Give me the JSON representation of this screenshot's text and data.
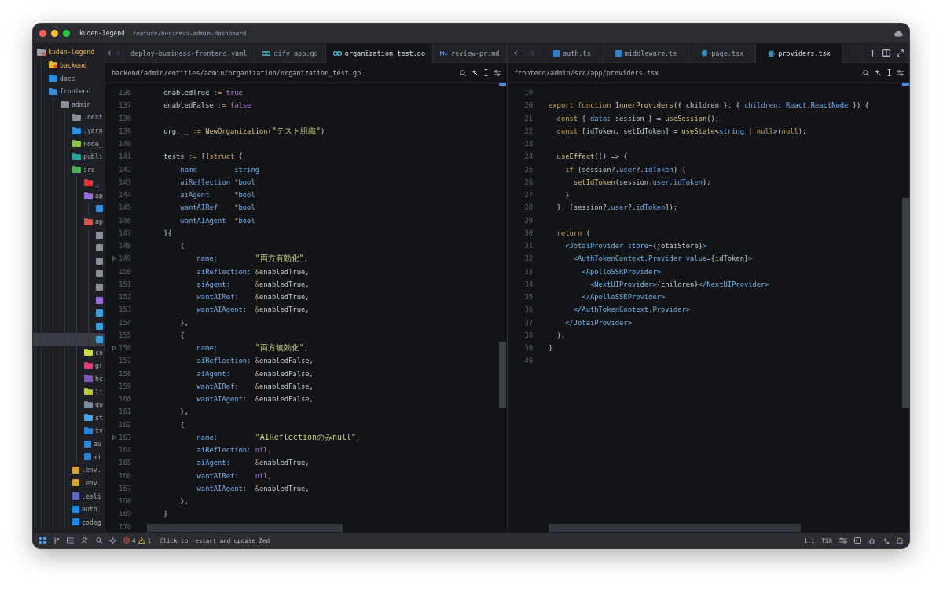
{
  "title_bar": {
    "project": "kuden-legend",
    "branch": "feature/business-admin-dashboard"
  },
  "sidebar": {
    "items": [
      {
        "label": "kuden-legend",
        "kind": "folder",
        "color": "#9aa0a8",
        "modified": true,
        "selected": false,
        "children": [
          {
            "label": "backend",
            "kind": "folder",
            "color": "#e8b730",
            "modified": true,
            "selected": false
          },
          {
            "label": "docs",
            "kind": "folder",
            "color": "#2f8fe0",
            "modified": false,
            "selected": false
          },
          {
            "label": "frontend",
            "kind": "folder",
            "color": "#3a8fd6",
            "modified": false,
            "selected": false,
            "children": [
              {
                "label": "admin",
                "kind": "folder",
                "color": "#8a8f98",
                "modified": false,
                "selected": false,
                "children": [
                  {
                    "label": ".next",
                    "kind": "folder",
                    "color": "#8a8f98",
                    "modified": false,
                    "selected": false
                  },
                  {
                    "label": ".yarn",
                    "kind": "folder",
                    "color": "#2f8fe0",
                    "modified": false,
                    "selected": false
                  },
                  {
                    "label": "node_",
                    "kind": "folder",
                    "color": "#8bc34a",
                    "modified": false,
                    "selected": false
                  },
                  {
                    "label": "publi",
                    "kind": "folder",
                    "color": "#26a69a",
                    "modified": false,
                    "selected": false
                  },
                  {
                    "label": "src",
                    "kind": "folder",
                    "color": "#4caf50",
                    "modified": false,
                    "selected": false,
                    "children": [
                      {
                        "label": "_",
                        "kind": "folder",
                        "color": "#e53935",
                        "modified": false,
                        "selected": false
                      },
                      {
                        "label": "ap",
                        "kind": "folder",
                        "color": "#9c6ade",
                        "modified": false,
                        "selected": false,
                        "children": [
                          {
                            "kind": "file",
                            "color": "#2f8fe0",
                            "modified": false,
                            "selected": false
                          }
                        ]
                      },
                      {
                        "label": "ap",
                        "kind": "folder",
                        "color": "#e35050",
                        "modified": false,
                        "selected": false,
                        "children": [
                          {
                            "kind": "file",
                            "color": "#8a8f98",
                            "modified": false,
                            "selected": false
                          },
                          {
                            "kind": "file",
                            "color": "#8a8f98",
                            "modified": false,
                            "selected": false
                          },
                          {
                            "kind": "file",
                            "color": "#8a8f98",
                            "modified": false,
                            "selected": false
                          },
                          {
                            "kind": "file",
                            "color": "#8a8f98",
                            "modified": false,
                            "selected": false
                          },
                          {
                            "kind": "file",
                            "color": "#8a8f98",
                            "modified": false,
                            "selected": false
                          },
                          {
                            "kind": "file",
                            "color": "#9c6ade",
                            "modified": false,
                            "selected": false
                          },
                          {
                            "kind": "file",
                            "color": "#3aa0e0",
                            "modified": false,
                            "selected": false
                          },
                          {
                            "kind": "file",
                            "color": "#3aa0e0",
                            "modified": false,
                            "selected": false
                          },
                          {
                            "kind": "file",
                            "color": "#3aa0e0",
                            "modified": false,
                            "selected": true
                          }
                        ]
                      },
                      {
                        "label": "co",
                        "kind": "folder",
                        "color": "#cddc39",
                        "modified": false,
                        "selected": false
                      },
                      {
                        "label": "gr",
                        "kind": "folder",
                        "color": "#ec407a",
                        "modified": false,
                        "selected": false
                      },
                      {
                        "label": "hc",
                        "kind": "folder",
                        "color": "#7e57c2",
                        "modified": false,
                        "selected": false
                      },
                      {
                        "label": "li",
                        "kind": "folder",
                        "color": "#c0ca33",
                        "modified": false,
                        "selected": false
                      },
                      {
                        "label": "qu",
                        "kind": "folder",
                        "color": "#78909c",
                        "modified": false,
                        "selected": false
                      },
                      {
                        "label": "st",
                        "kind": "folder",
                        "color": "#42a5f5",
                        "modified": false,
                        "selected": false
                      },
                      {
                        "label": "ty",
                        "kind": "folder",
                        "color": "#1e88e5",
                        "modified": false,
                        "selected": false
                      },
                      {
                        "label": "au",
                        "kind": "file",
                        "color": "#1e88e5",
                        "modified": false,
                        "selected": false
                      },
                      {
                        "label": "mi",
                        "kind": "file",
                        "color": "#1e88e5",
                        "modified": false,
                        "selected": false
                      }
                    ]
                  },
                  {
                    "label": ".env.",
                    "kind": "file",
                    "color": "#d4a72c",
                    "modified": false,
                    "selected": false
                  },
                  {
                    "label": ".env.",
                    "kind": "file",
                    "color": "#d4a72c",
                    "modified": false,
                    "selected": false
                  },
                  {
                    "label": ".esli",
                    "kind": "file",
                    "color": "#5c6bc0",
                    "modified": false,
                    "selected": false
                  },
                  {
                    "label": "auth.",
                    "kind": "file",
                    "color": "#1e88e5",
                    "modified": false,
                    "selected": false
                  },
                  {
                    "label": "codeg",
                    "kind": "file",
                    "color": "#1e88e5",
                    "modified": false,
                    "selected": false
                  }
                ]
              }
            ]
          }
        ]
      }
    ]
  },
  "panes": [
    {
      "tabs": [
        {
          "label": "deploy-business-frontend.yaml",
          "selected": false
        },
        {
          "label": "dify_app.go",
          "kind": "go",
          "selected": false
        },
        {
          "label": "organization_test.go",
          "kind": "go",
          "selected": true
        },
        {
          "label": "review-pr.md",
          "kind": "md",
          "selected": false
        }
      ],
      "path": "backend/admin/entities/admin/organization/organization_test.go",
      "lines": [
        {
          "number": "136",
          "fold": false,
          "tokens": [
            {
              "kind": "plain",
              "text": "    enabledTrue "
            },
            {
              "kind": "operator",
              "text": ":= "
            },
            {
              "kind": "literal",
              "text": "true"
            }
          ]
        },
        {
          "number": "137",
          "fold": false,
          "tokens": [
            {
              "kind": "plain",
              "text": "    enabledFalse "
            },
            {
              "kind": "operator",
              "text": ":= "
            },
            {
              "kind": "literal",
              "text": "false"
            }
          ]
        },
        {
          "number": "138",
          "fold": false
        },
        {
          "number": "139",
          "fold": false,
          "tokens": [
            {
              "kind": "plain",
              "text": "    org, _ "
            },
            {
              "kind": "operator",
              "text": ":= "
            },
            {
              "kind": "function",
              "text": "NewOrganization"
            },
            {
              "kind": "plain",
              "text": "("
            },
            {
              "kind": "string",
              "text": "\"テスト組織\""
            },
            {
              "kind": "plain",
              "text": ")"
            }
          ]
        },
        {
          "number": "140",
          "fold": false
        },
        {
          "number": "141",
          "fold": false,
          "tokens": [
            {
              "kind": "plain",
              "text": "    tests "
            },
            {
              "kind": "operator",
              "text": ":="
            },
            {
              "kind": "plain",
              "text": " []"
            },
            {
              "kind": "keyword",
              "text": "struct"
            },
            {
              "kind": "plain",
              "text": " {"
            }
          ]
        },
        {
          "number": "142",
          "fold": false,
          "tokens": [
            {
              "kind": "field",
              "text": "        name         "
            },
            {
              "kind": "type",
              "text": "string"
            }
          ]
        },
        {
          "number": "143",
          "fold": false,
          "tokens": [
            {
              "kind": "field",
              "text": "        aiReflection "
            },
            {
              "kind": "operator",
              "text": "*"
            },
            {
              "kind": "type",
              "text": "bool"
            }
          ]
        },
        {
          "number": "144",
          "fold": false,
          "tokens": [
            {
              "kind": "field",
              "text": "        aiAgent      "
            },
            {
              "kind": "operator",
              "text": "*"
            },
            {
              "kind": "type",
              "text": "bool"
            }
          ]
        },
        {
          "number": "145",
          "fold": false,
          "tokens": [
            {
              "kind": "field",
              "text": "        wantAIRef    "
            },
            {
              "kind": "operator",
              "text": "*"
            },
            {
              "kind": "type",
              "text": "bool"
            }
          ]
        },
        {
          "number": "146",
          "fold": false,
          "tokens": [
            {
              "kind": "field",
              "text": "        wantAIAgent  "
            },
            {
              "kind": "operator",
              "text": "*"
            },
            {
              "kind": "type",
              "text": "bool"
            }
          ]
        },
        {
          "number": "147",
          "fold": false,
          "tokens": [
            {
              "kind": "plain",
              "text": "    }{"
            }
          ]
        },
        {
          "number": "148",
          "fold": false,
          "tokens": [
            {
              "kind": "plain",
              "text": "        {"
            }
          ]
        },
        {
          "number": "149",
          "fold": true,
          "tokens": [
            {
              "kind": "field",
              "text": "            name:         "
            },
            {
              "kind": "string",
              "text": "\"両方有効化\""
            },
            {
              "kind": "plain",
              "text": ","
            }
          ]
        },
        {
          "number": "150",
          "fold": false,
          "tokens": [
            {
              "kind": "field",
              "text": "            aiReflection: "
            },
            {
              "kind": "operator",
              "text": "&"
            },
            {
              "kind": "plain",
              "text": "enabledTrue,"
            }
          ]
        },
        {
          "number": "151",
          "fold": false,
          "tokens": [
            {
              "kind": "field",
              "text": "            aiAgent:      "
            },
            {
              "kind": "operator",
              "text": "&"
            },
            {
              "kind": "plain",
              "text": "enabledTrue,"
            }
          ]
        },
        {
          "number": "152",
          "fold": false,
          "tokens": [
            {
              "kind": "field",
              "text": "            wantAIRef:    "
            },
            {
              "kind": "operator",
              "text": "&"
            },
            {
              "kind": "plain",
              "text": "enabledTrue,"
            }
          ]
        },
        {
          "number": "153",
          "fold": false,
          "tokens": [
            {
              "kind": "field",
              "text": "            wantAIAgent:  "
            },
            {
              "kind": "operator",
              "text": "&"
            },
            {
              "kind": "plain",
              "text": "enabledTrue,"
            }
          ]
        },
        {
          "number": "154",
          "fold": false,
          "tokens": [
            {
              "kind": "plain",
              "text": "        },"
            }
          ]
        },
        {
          "number": "155",
          "fold": false,
          "tokens": [
            {
              "kind": "plain",
              "text": "        {"
            }
          ]
        },
        {
          "number": "156",
          "fold": true,
          "tokens": [
            {
              "kind": "field",
              "text": "            name:         "
            },
            {
              "kind": "string",
              "text": "\"両方無効化\""
            },
            {
              "kind": "plain",
              "text": ","
            }
          ]
        },
        {
          "number": "157",
          "fold": false,
          "tokens": [
            {
              "kind": "field",
              "text": "            aiReflection: "
            },
            {
              "kind": "operator",
              "text": "&"
            },
            {
              "kind": "plain",
              "text": "enabledFalse,"
            }
          ]
        },
        {
          "number": "158",
          "fold": false,
          "tokens": [
            {
              "kind": "field",
              "text": "            aiAgent:      "
            },
            {
              "kind": "operator",
              "text": "&"
            },
            {
              "kind": "plain",
              "text": "enabledFalse,"
            }
          ]
        },
        {
          "number": "159",
          "fold": false,
          "tokens": [
            {
              "kind": "field",
              "text": "            wantAIRef:    "
            },
            {
              "kind": "operator",
              "text": "&"
            },
            {
              "kind": "plain",
              "text": "enabledFalse,"
            }
          ]
        },
        {
          "number": "160",
          "fold": false,
          "tokens": [
            {
              "kind": "field",
              "text": "            wantAIAgent:  "
            },
            {
              "kind": "operator",
              "text": "&"
            },
            {
              "kind": "plain",
              "text": "enabledFalse,"
            }
          ]
        },
        {
          "number": "161",
          "fold": false,
          "tokens": [
            {
              "kind": "plain",
              "text": "        },"
            }
          ]
        },
        {
          "number": "162",
          "fold": false,
          "tokens": [
            {
              "kind": "plain",
              "text": "        {"
            }
          ]
        },
        {
          "number": "163",
          "fold": true,
          "tokens": [
            {
              "kind": "field",
              "text": "            name:         "
            },
            {
              "kind": "string",
              "text": "\"AIReflectionのみnull\""
            },
            {
              "kind": "plain",
              "text": ","
            }
          ]
        },
        {
          "number": "164",
          "fold": false,
          "tokens": [
            {
              "kind": "field",
              "text": "            aiReflection: "
            },
            {
              "kind": "literal",
              "text": "nil"
            },
            {
              "kind": "plain",
              "text": ","
            }
          ]
        },
        {
          "number": "165",
          "fold": false,
          "tokens": [
            {
              "kind": "field",
              "text": "            aiAgent:      "
            },
            {
              "kind": "operator",
              "text": "&"
            },
            {
              "kind": "plain",
              "text": "enabledTrue,"
            }
          ]
        },
        {
          "number": "166",
          "fold": false,
          "tokens": [
            {
              "kind": "field",
              "text": "            wantAIRef:    "
            },
            {
              "kind": "literal",
              "text": "nil"
            },
            {
              "kind": "plain",
              "text": ","
            }
          ]
        },
        {
          "number": "167",
          "fold": false,
          "tokens": [
            {
              "kind": "field",
              "text": "            wantAIAgent:  "
            },
            {
              "kind": "operator",
              "text": "&"
            },
            {
              "kind": "plain",
              "text": "enabledTrue,"
            }
          ]
        },
        {
          "number": "168",
          "fold": false,
          "tokens": [
            {
              "kind": "plain",
              "text": "        },"
            }
          ]
        },
        {
          "number": "169",
          "fold": false,
          "tokens": [
            {
              "kind": "plain",
              "text": "    }"
            }
          ]
        },
        {
          "number": "170",
          "fold": false
        }
      ]
    },
    {
      "tabs": [
        {
          "label": "auth.ts",
          "kind": "ts",
          "selected": false
        },
        {
          "label": "middleware.ts",
          "kind": "ts",
          "selected": false
        },
        {
          "label": "page.tsx",
          "kind": "react",
          "selected": false
        },
        {
          "label": "providers.tsx",
          "kind": "react",
          "selected": true
        }
      ],
      "tab_bar_buttons": true,
      "path": "frontend/admin/src/app/providers.tsx",
      "lines": [
        {
          "number": "19"
        },
        {
          "number": "20",
          "tokens": [
            {
              "kind": "keyword",
              "text": "export function "
            },
            {
              "kind": "function",
              "text": "InnerProviders"
            },
            {
              "kind": "plain",
              "text": "({ children }: { "
            },
            {
              "kind": "field",
              "text": "children"
            },
            {
              "kind": "plain",
              "text": ": "
            },
            {
              "kind": "type",
              "text": "React.ReactNode"
            },
            {
              "kind": "plain",
              "text": " }) {"
            }
          ]
        },
        {
          "number": "21",
          "tokens": [
            {
              "kind": "keyword",
              "text": "  const"
            },
            {
              "kind": "plain",
              "text": " { "
            },
            {
              "kind": "field",
              "text": "data"
            },
            {
              "kind": "plain",
              "text": ": session } = "
            },
            {
              "kind": "function",
              "text": "useSession"
            },
            {
              "kind": "plain",
              "text": "();"
            }
          ]
        },
        {
          "number": "22",
          "tokens": [
            {
              "kind": "keyword",
              "text": "  const"
            },
            {
              "kind": "plain",
              "text": " [idToken, setIdToken] = "
            },
            {
              "kind": "function",
              "text": "useState"
            },
            {
              "kind": "plain",
              "text": "<"
            },
            {
              "kind": "type",
              "text": "string"
            },
            {
              "kind": "plain",
              "text": " | "
            },
            {
              "kind": "keyword",
              "text": "null"
            },
            {
              "kind": "plain",
              "text": ">("
            },
            {
              "kind": "keyword",
              "text": "null"
            },
            {
              "kind": "plain",
              "text": ");"
            }
          ]
        },
        {
          "number": "23"
        },
        {
          "number": "24",
          "tokens": [
            {
              "kind": "function",
              "text": "  useEffect"
            },
            {
              "kind": "plain",
              "text": "(() => {"
            }
          ]
        },
        {
          "number": "25",
          "tokens": [
            {
              "kind": "keyword",
              "text": "    if"
            },
            {
              "kind": "plain",
              "text": " (session?."
            },
            {
              "kind": "field",
              "text": "user"
            },
            {
              "kind": "plain",
              "text": "?."
            },
            {
              "kind": "field",
              "text": "idToken"
            },
            {
              "kind": "plain",
              "text": ") {"
            }
          ]
        },
        {
          "number": "26",
          "tokens": [
            {
              "kind": "function",
              "text": "      setIdToken"
            },
            {
              "kind": "plain",
              "text": "(session."
            },
            {
              "kind": "field",
              "text": "user"
            },
            {
              "kind": "plain",
              "text": "."
            },
            {
              "kind": "field",
              "text": "idToken"
            },
            {
              "kind": "plain",
              "text": ");"
            }
          ]
        },
        {
          "number": "27",
          "tokens": [
            {
              "kind": "plain",
              "text": "    }"
            }
          ]
        },
        {
          "number": "28",
          "tokens": [
            {
              "kind": "plain",
              "text": "  }, [session?."
            },
            {
              "kind": "field",
              "text": "user"
            },
            {
              "kind": "plain",
              "text": "?."
            },
            {
              "kind": "field",
              "text": "idToken"
            },
            {
              "kind": "plain",
              "text": "]);"
            }
          ]
        },
        {
          "number": "29"
        },
        {
          "number": "30",
          "tokens": [
            {
              "kind": "keyword",
              "text": "  return"
            },
            {
              "kind": "plain",
              "text": " ("
            }
          ]
        },
        {
          "number": "31",
          "tokens": [
            {
              "kind": "tag",
              "text": "    <JotaiProvider "
            },
            {
              "kind": "field",
              "text": "store"
            },
            {
              "kind": "plain",
              "text": "={jotaiStore}"
            },
            {
              "kind": "tag",
              "text": ">"
            }
          ]
        },
        {
          "number": "32",
          "tokens": [
            {
              "kind": "tag",
              "text": "      <AuthTokenContext.Provider "
            },
            {
              "kind": "field",
              "text": "value"
            },
            {
              "kind": "plain",
              "text": "={idToken}"
            },
            {
              "kind": "tag",
              "text": ">"
            }
          ]
        },
        {
          "number": "33",
          "tokens": [
            {
              "kind": "tag",
              "text": "        <ApolloSSRProvider>"
            }
          ]
        },
        {
          "number": "34",
          "tokens": [
            {
              "kind": "tag",
              "text": "          <NextUIProvider>"
            },
            {
              "kind": "plain",
              "text": "{children}"
            },
            {
              "kind": "tag",
              "text": "</NextUIProvider>"
            }
          ]
        },
        {
          "number": "35",
          "tokens": [
            {
              "kind": "tag",
              "text": "        </ApolloSSRProvider>"
            }
          ]
        },
        {
          "number": "36",
          "tokens": [
            {
              "kind": "tag",
              "text": "      </AuthTokenContext.Provider>"
            }
          ]
        },
        {
          "number": "37",
          "tokens": [
            {
              "kind": "tag",
              "text": "    </JotaiProvider>"
            }
          ]
        },
        {
          "number": "38",
          "tokens": [
            {
              "kind": "plain",
              "text": "  );"
            }
          ]
        },
        {
          "number": "39",
          "tokens": [
            {
              "kind": "plain",
              "text": "}"
            }
          ]
        },
        {
          "number": "40"
        }
      ]
    }
  ],
  "status_bar": {
    "errors": "4",
    "warnings": "1",
    "message": "Click to restart and update Zed",
    "cursor": "1:1",
    "language": "TSX"
  }
}
